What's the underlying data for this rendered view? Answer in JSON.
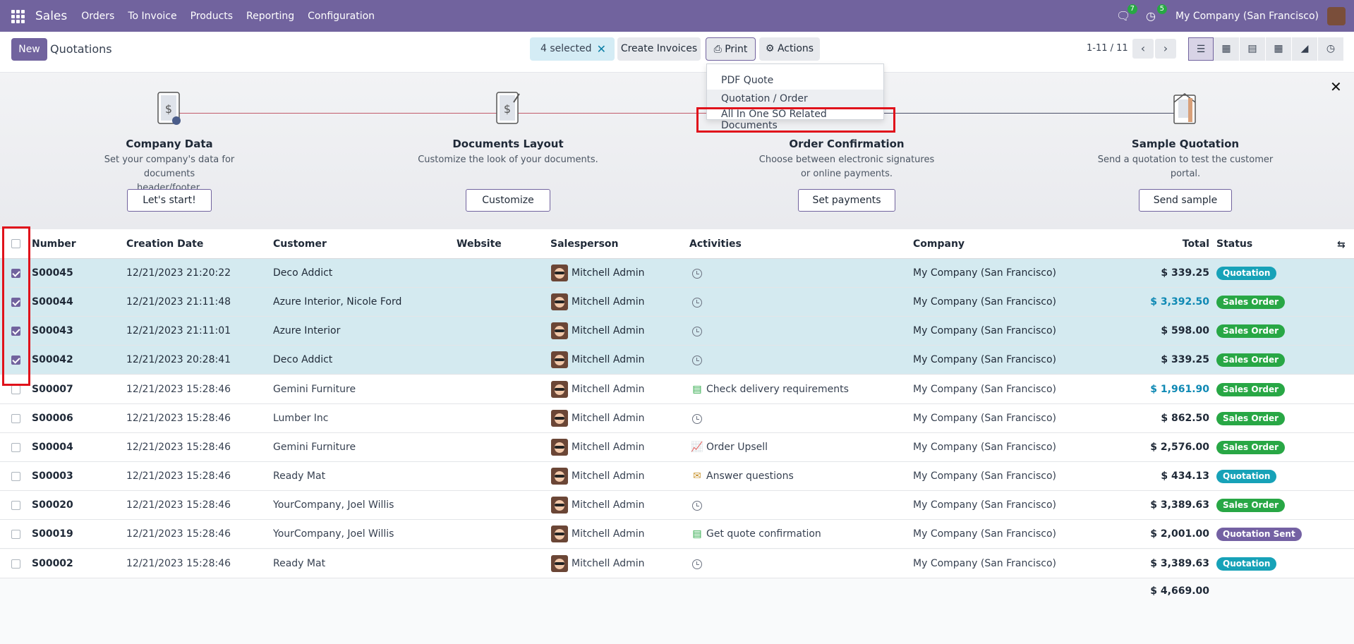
{
  "topbar": {
    "app_name": "Sales",
    "menu": [
      "Orders",
      "To Invoice",
      "Products",
      "Reporting",
      "Configuration"
    ],
    "messages_count": "7",
    "activities_count": "5",
    "company": "My Company (San Francisco)"
  },
  "control": {
    "new_label": "New",
    "title": "Quotations",
    "selected_label": "4 selected",
    "create_invoices_label": "Create Invoices",
    "print_label": "Print",
    "actions_label": "Actions",
    "pager": "1-11 / 11"
  },
  "print_menu": {
    "items": [
      "PDF Quote",
      "Quotation / Order",
      "All In One SO Related Documents"
    ]
  },
  "banner": {
    "steps": [
      {
        "title": "Company Data",
        "desc_1": "Set your company's data for documents",
        "desc_2": "header/footer.",
        "button": "Let's start!"
      },
      {
        "title": "Documents Layout",
        "desc_1": "Customize the look of your documents.",
        "desc_2": "",
        "button": "Customize"
      },
      {
        "title": "Order Confirmation",
        "desc_1": "Choose between electronic signatures",
        "desc_2": "or online payments.",
        "button": "Set payments"
      },
      {
        "title": "Sample Quotation",
        "desc_1": "Send a quotation to test the customer",
        "desc_2": "portal.",
        "button": "Send sample"
      }
    ]
  },
  "table": {
    "headers": {
      "number": "Number",
      "creation_date": "Creation Date",
      "customer": "Customer",
      "website": "Website",
      "salesperson": "Salesperson",
      "activities": "Activities",
      "company": "Company",
      "total": "Total",
      "status": "Status"
    },
    "rows": [
      {
        "number": "S00045",
        "date": "12/21/2023 21:20:22",
        "customer": "Deco Addict",
        "salesperson": "Mitchell Admin",
        "activity": "",
        "activity_icon": "clock-icon",
        "company": "My Company (San Francisco)",
        "total": "$ 339.25",
        "status": "Quotation"
      },
      {
        "number": "S00044",
        "date": "12/21/2023 21:11:48",
        "customer": "Azure Interior, Nicole Ford",
        "salesperson": "Mitchell Admin",
        "activity": "",
        "activity_icon": "clock-icon",
        "company": "My Company (San Francisco)",
        "total": "$ 3,392.50",
        "status": "Sales Order"
      },
      {
        "number": "S00043",
        "date": "12/21/2023 21:11:01",
        "customer": "Azure Interior",
        "salesperson": "Mitchell Admin",
        "activity": "",
        "activity_icon": "clock-icon",
        "company": "My Company (San Francisco)",
        "total": "$ 598.00",
        "status": "Sales Order"
      },
      {
        "number": "S00042",
        "date": "12/21/2023 20:28:41",
        "customer": "Deco Addict",
        "salesperson": "Mitchell Admin",
        "activity": "",
        "activity_icon": "clock-icon",
        "company": "My Company (San Francisco)",
        "total": "$ 339.25",
        "status": "Sales Order"
      },
      {
        "number": "S00007",
        "date": "12/21/2023 15:28:46",
        "customer": "Gemini Furniture",
        "salesperson": "Mitchell Admin",
        "activity": "Check delivery requirements",
        "activity_icon": "checklist-icon",
        "company": "My Company (San Francisco)",
        "total": "$ 1,961.90",
        "status": "Sales Order"
      },
      {
        "number": "S00006",
        "date": "12/21/2023 15:28:46",
        "customer": "Lumber Inc",
        "salesperson": "Mitchell Admin",
        "activity": "",
        "activity_icon": "clock-icon",
        "company": "My Company (San Francisco)",
        "total": "$ 862.50",
        "status": "Sales Order"
      },
      {
        "number": "S00004",
        "date": "12/21/2023 15:28:46",
        "customer": "Gemini Furniture",
        "salesperson": "Mitchell Admin",
        "activity": "Order Upsell",
        "activity_icon": "chart-icon",
        "company": "My Company (San Francisco)",
        "total": "$ 2,576.00",
        "status": "Sales Order"
      },
      {
        "number": "S00003",
        "date": "12/21/2023 15:28:46",
        "customer": "Ready Mat",
        "salesperson": "Mitchell Admin",
        "activity": "Answer questions",
        "activity_icon": "envelope-icon",
        "company": "My Company (San Francisco)",
        "total": "$ 434.13",
        "status": "Quotation"
      },
      {
        "number": "S00020",
        "date": "12/21/2023 15:28:46",
        "customer": "YourCompany, Joel Willis",
        "salesperson": "Mitchell Admin",
        "activity": "",
        "activity_icon": "clock-icon",
        "company": "My Company (San Francisco)",
        "total": "$ 3,389.63",
        "status": "Sales Order"
      },
      {
        "number": "S00019",
        "date": "12/21/2023 15:28:46",
        "customer": "YourCompany, Joel Willis",
        "salesperson": "Mitchell Admin",
        "activity": "Get quote confirmation",
        "activity_icon": "checklist-icon",
        "company": "My Company (San Francisco)",
        "total": "$ 2,001.00",
        "status": "Quotation Sent"
      },
      {
        "number": "S00002",
        "date": "12/21/2023 15:28:46",
        "customer": "Ready Mat",
        "salesperson": "Mitchell Admin",
        "activity": "",
        "activity_icon": "clock-icon",
        "company": "My Company (San Francisco)",
        "total": "$ 3,389.63",
        "status": "Quotation"
      }
    ],
    "sum_total": "$ 4,669.00"
  },
  "colors": {
    "brand": "#71639e",
    "quotation": "#17a2b8",
    "sales_order": "#28a745",
    "quotation_sent": "#7461a3",
    "selected_row": "#d4eaf0",
    "highlight": "#e0121b"
  }
}
